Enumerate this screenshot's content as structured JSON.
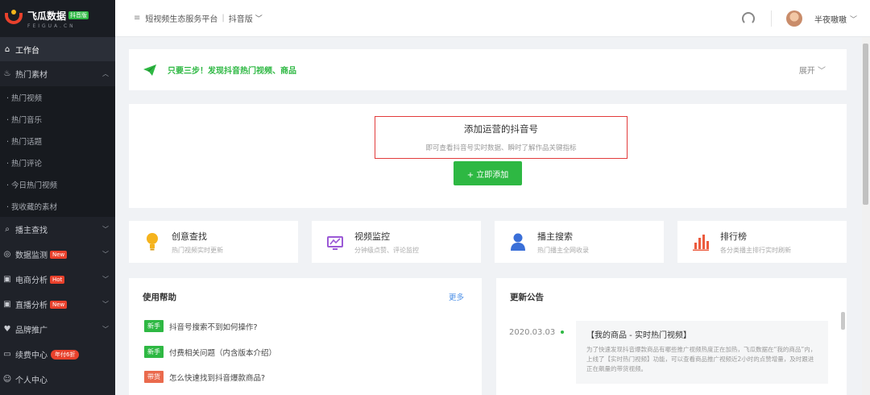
{
  "brand": {
    "name": "飞瓜数据",
    "badge": "抖音版",
    "sub": "FEIGUA.CN"
  },
  "sidebar": {
    "items": [
      {
        "label": "工作台",
        "icon": "home-icon",
        "active": true
      },
      {
        "label": "热门素材",
        "icon": "flame-icon",
        "expanded": true
      },
      {
        "label": "播主查找",
        "icon": "search-icon"
      },
      {
        "label": "数据监测",
        "icon": "monitor-icon",
        "badge": "New"
      },
      {
        "label": "电商分析",
        "icon": "briefcase-icon",
        "badge": "Hot"
      },
      {
        "label": "直播分析",
        "icon": "briefcase-icon",
        "badge": "New"
      },
      {
        "label": "品牌推广",
        "icon": "heart-icon"
      },
      {
        "label": "续费中心",
        "icon": "card-icon",
        "badge": "年付6折"
      },
      {
        "label": "个人中心",
        "icon": "user-icon"
      }
    ],
    "sub_items": [
      "· 热门视频",
      "· 热门音乐",
      "· 热门话题",
      "· 热门评论",
      "· 今日热门视频",
      "· 我收藏的素材"
    ]
  },
  "topbar": {
    "platform": "短视频生态服务平台",
    "version": "抖音版",
    "username": "半夜嗷嗷"
  },
  "steps": {
    "text": "只要三步！发现抖音热门视频、商品",
    "expand": "展开"
  },
  "add_account": {
    "title": "添加运营的抖音号",
    "desc": "即可查看抖音号实时数据、瞬时了解作品关键指标",
    "button": "+ 立即添加"
  },
  "features": [
    {
      "title": "创意查找",
      "desc": "热门视频实时更新",
      "icon": "bulb-icon"
    },
    {
      "title": "视频监控",
      "desc": "分钟级点赞、评论监控",
      "icon": "chart-monitor-icon"
    },
    {
      "title": "播主搜索",
      "desc": "热门播主全网收录",
      "icon": "user-search-icon"
    },
    {
      "title": "排行榜",
      "desc": "各分类播主排行实时刷新",
      "icon": "bar-chart-icon"
    }
  ],
  "help": {
    "title": "使用帮助",
    "more": "更多",
    "items": [
      {
        "tag": "新手",
        "tag_color": "#2eb843",
        "question": "抖音号搜索不到如何操作?"
      },
      {
        "tag": "新手",
        "tag_color": "#2eb843",
        "question": "付费相关问题（内含版本介绍）"
      },
      {
        "tag": "带货",
        "tag_color": "#ea6a4d",
        "question": "怎么快速找到抖音爆款商品?"
      }
    ]
  },
  "news": {
    "title": "更新公告",
    "date": "2020.03.03",
    "headline": "【我的商品 - 实时热门视频】",
    "body": "为了快速发现抖音爆款商品有哪些推广视频热度正在加热，飞瓜数据在“我的商品”内，上线了【实时热门视频】功能，可以查看商品推广视频近2小时的点赞增量，及时跟进正在飙量的带货视频。"
  },
  "colors": {
    "accent": "#2eb843",
    "sidebar_bg": "#1f2229",
    "highlight_border": "#e23b3b"
  }
}
